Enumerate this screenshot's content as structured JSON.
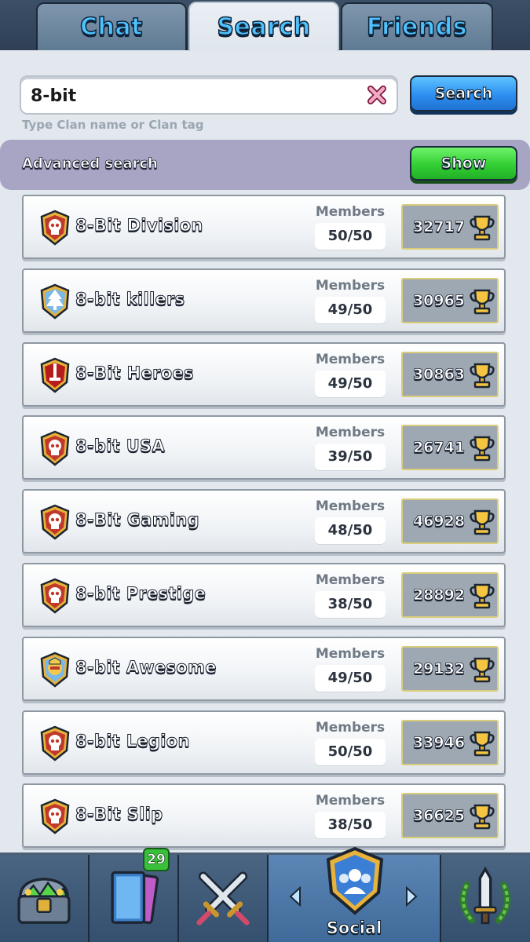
{
  "tabs": [
    {
      "label": "Chat",
      "active": false
    },
    {
      "label": "Search",
      "active": true
    },
    {
      "label": "Friends",
      "active": false
    }
  ],
  "search": {
    "value": "8-bit",
    "hint": "Type Clan name or Clan tag",
    "button_label": "Search"
  },
  "advanced": {
    "label": "Advanced search",
    "button_label": "Show"
  },
  "members_label": "Members",
  "clans": [
    {
      "name": "8-Bit Division",
      "members": "50/50",
      "trophies": "32717",
      "badge_color": "#c0392b",
      "badge_icon": "skull-icon"
    },
    {
      "name": "8-bit killers",
      "members": "49/50",
      "trophies": "30965",
      "badge_color": "#7ab8e8",
      "badge_icon": "tree-icon"
    },
    {
      "name": "8-Bit Heroes",
      "members": "49/50",
      "trophies": "30863",
      "badge_color": "#b71c1c",
      "badge_icon": "sword-icon"
    },
    {
      "name": "8-bit USA",
      "members": "39/50",
      "trophies": "26741",
      "badge_color": "#c0392b",
      "badge_icon": "skull-icon"
    },
    {
      "name": "8-Bit Gaming",
      "members": "48/50",
      "trophies": "46928",
      "badge_color": "#c0392b",
      "badge_icon": "skull-icon"
    },
    {
      "name": "8-bit Prestige",
      "members": "38/50",
      "trophies": "28892",
      "badge_color": "#c0392b",
      "badge_icon": "skull-icon"
    },
    {
      "name": "8-bit Awesome",
      "members": "49/50",
      "trophies": "29132",
      "badge_color": "#7ab8e8",
      "badge_icon": "knight-icon"
    },
    {
      "name": "8-bit Legion",
      "members": "50/50",
      "trophies": "33946",
      "badge_color": "#c0392b",
      "badge_icon": "skull-icon"
    },
    {
      "name": "8-Bit Slip",
      "members": "38/50",
      "trophies": "36625",
      "badge_color": "#c0392b",
      "badge_icon": "skull-icon"
    }
  ],
  "nav": {
    "items": [
      {
        "icon": "chest-icon",
        "label": ""
      },
      {
        "icon": "cards-icon",
        "label": ""
      },
      {
        "icon": "crossed-swords-icon",
        "label": ""
      },
      {
        "icon": "social-icon",
        "label": "Social",
        "active": true
      },
      {
        "icon": "tournament-icon",
        "label": ""
      }
    ],
    "cards_badge": "29"
  },
  "colors": {
    "tab_text": "#4ec3ff",
    "search_button": "#2d8ff0",
    "show_button": "#33cf35",
    "advanced_bar": "#a7a4c4"
  }
}
